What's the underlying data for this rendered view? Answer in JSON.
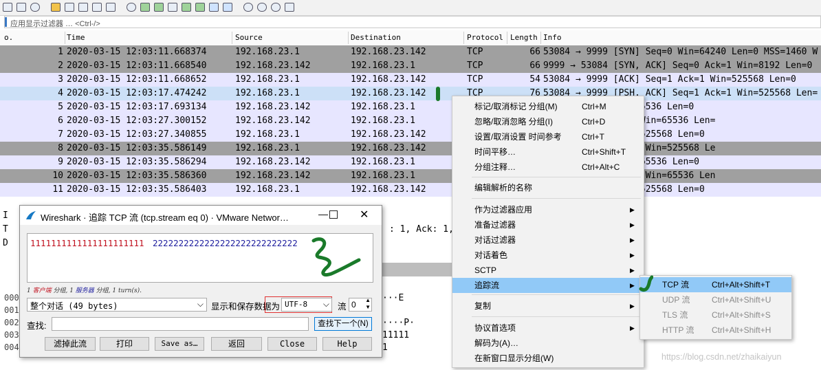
{
  "filter": {
    "placeholder": "应用显示过滤器 … <Ctrl-/>"
  },
  "columns": {
    "no": "o.",
    "time": "Time",
    "source": "Source",
    "destination": "Destination",
    "protocol": "Protocol",
    "length": "Length",
    "info": "Info"
  },
  "packets": [
    {
      "no": "1",
      "time": "2020-03-15 12:03:11.668374",
      "src": "192.168.23.1",
      "dst": "192.168.23.142",
      "proto": "TCP",
      "len": "66",
      "info": "53084 → 9999 [SYN] Seq=0 Win=64240 Len=0 MSS=1460 W"
    },
    {
      "no": "2",
      "time": "2020-03-15 12:03:11.668540",
      "src": "192.168.23.142",
      "dst": "192.168.23.1",
      "proto": "TCP",
      "len": "66",
      "info": "9999 → 53084 [SYN, ACK] Seq=0 Ack=1 Win=8192 Len=0"
    },
    {
      "no": "3",
      "time": "2020-03-15 12:03:11.668652",
      "src": "192.168.23.1",
      "dst": "192.168.23.142",
      "proto": "TCP",
      "len": "54",
      "info": "53084 → 9999 [ACK] Seq=1 Ack=1 Win=525568 Len=0"
    },
    {
      "no": "4",
      "time": "2020-03-15 12:03:17.474242",
      "src": "192.168.23.1",
      "dst": "192.168.23.142",
      "proto": "TCP",
      "len": "76",
      "info": "53084 → 9999 [PSH, ACK] Seq=1 Ack=1 Win=525568 Len="
    },
    {
      "no": "5",
      "time": "2020-03-15 12:03:17.693134",
      "src": "192.168.23.142",
      "dst": "192.168.23.1",
      "proto": "",
      "len": "",
      "info": "Seq=1 Ack=23 Win=65536 Len=0"
    },
    {
      "no": "6",
      "time": "2020-03-15 12:03:27.300152",
      "src": "192.168.23.142",
      "dst": "192.168.23.1",
      "proto": "",
      "len": "",
      "info": "ACK] Seq=1 Ack=23 Win=65536 Len="
    },
    {
      "no": "7",
      "time": "2020-03-15 12:03:27.340855",
      "src": "192.168.23.1",
      "dst": "192.168.23.142",
      "proto": "",
      "len": "",
      "info": "Seq=23 Ack=28 Win=525568 Len=0"
    },
    {
      "no": "8",
      "time": "2020-03-15 12:03:35.586149",
      "src": "192.168.23.1",
      "dst": "192.168.23.142",
      "proto": "",
      "len": "",
      "info": "ACK] Seq=23 Ack=28 Win=525568 Le"
    },
    {
      "no": "9",
      "time": "2020-03-15 12:03:35.586294",
      "src": "192.168.23.142",
      "dst": "192.168.23.1",
      "proto": "",
      "len": "",
      "info": "Seq=28 Ack=24 Win=65536 Len=0"
    },
    {
      "no": "10",
      "time": "2020-03-15 12:03:35.586360",
      "src": "192.168.23.142",
      "dst": "192.168.23.1",
      "proto": "",
      "len": "",
      "info": "ACK] Seq=28 Ack=24 Win=65536 Len"
    },
    {
      "no": "11",
      "time": "2020-03-15 12:03:35.586403",
      "src": "192.168.23.1",
      "dst": "192.168.23.142",
      "proto": "",
      "len": "",
      "info": "Seq=24 Ack=29 Win=525568 Len=0"
    }
  ],
  "background": {
    "tree_fragment": ": 1, Ack: 1,",
    "hex_fragments": [
      "···E",
      "····P·",
      "11111",
      "1"
    ],
    "offsets": [
      "000",
      "001",
      "002",
      "003",
      "004"
    ],
    "tree_markers": [
      "I",
      "T",
      "D"
    ]
  },
  "dialog": {
    "title": "Wireshark · 追踪 TCP 流 (tcp.stream eq 0) · VMware Networ…",
    "client_text": "1111111111111111111111",
    "server_text": "2222222222222222222222222222",
    "summary_parts": [
      "1 ",
      "客户端",
      " 分组, 1 ",
      "服务器",
      " 分组, 1 turn(s)."
    ],
    "conversation": "整个对话 (49 bytes)",
    "show_as_label": "显示和保存数据为",
    "encoding": "UTF-8",
    "stream_label": "流",
    "stream_value": "0",
    "find_label": "查找:",
    "find_value": "",
    "find_next": "查找下一个(N)",
    "buttons": [
      "滤掉此流",
      "打印",
      "Save as…",
      "返回",
      "Close",
      "Help"
    ]
  },
  "context_menu": {
    "items": [
      {
        "label": "标记/取消标记 分组(M)",
        "shortcut": "Ctrl+M"
      },
      {
        "label": "忽略/取消忽略 分组(I)",
        "shortcut": "Ctrl+D"
      },
      {
        "label": "设置/取消设置 时间参考",
        "shortcut": "Ctrl+T"
      },
      {
        "label": "时间平移…",
        "shortcut": "Ctrl+Shift+T"
      },
      {
        "label": "分组注释…",
        "shortcut": "Ctrl+Alt+C"
      },
      {
        "label": "编辑解析的名称",
        "shortcut": ""
      },
      {
        "label": "作为过滤器应用",
        "shortcut": "",
        "submenu": true
      },
      {
        "label": "准备过滤器",
        "shortcut": "",
        "submenu": true
      },
      {
        "label": "对话过滤器",
        "shortcut": "",
        "submenu": true
      },
      {
        "label": "对话着色",
        "shortcut": "",
        "submenu": true
      },
      {
        "label": "SCTP",
        "shortcut": "",
        "submenu": true
      },
      {
        "label": "追踪流",
        "shortcut": "",
        "submenu": true
      },
      {
        "label": "复制",
        "shortcut": "",
        "submenu": true
      },
      {
        "label": "协议首选项",
        "shortcut": "",
        "submenu": true
      },
      {
        "label": "解码为(A)…",
        "shortcut": ""
      },
      {
        "label": "在新窗口显示分组(W)",
        "shortcut": ""
      }
    ]
  },
  "submenu": {
    "items": [
      {
        "label": "TCP 流",
        "shortcut": "Ctrl+Alt+Shift+T",
        "enabled": true
      },
      {
        "label": "UDP 流",
        "shortcut": "Ctrl+Alt+Shift+U",
        "enabled": false
      },
      {
        "label": "TLS 流",
        "shortcut": "Ctrl+Alt+Shift+S",
        "enabled": false
      },
      {
        "label": "HTTP 流",
        "shortcut": "Ctrl+Alt+Shift+H",
        "enabled": false
      }
    ]
  },
  "watermark": "https://blog.csdn.net/zhaikaiyun",
  "colors": {
    "row_gray": "#a0a0a0",
    "row_lilac": "#e7e6ff",
    "row_selected": "#cce0f7",
    "menu_highlight": "#91c9f7",
    "annotation_green": "#1a7a2a",
    "client_red": "#c0101e",
    "server_blue": "#1d1d9e"
  }
}
